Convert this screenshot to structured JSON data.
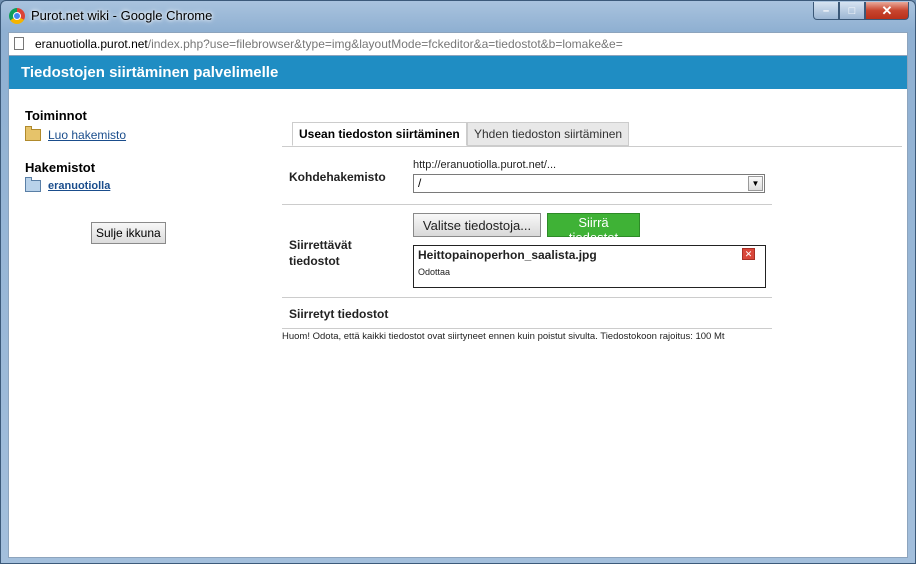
{
  "window": {
    "title": "Purot.net wiki - Google Chrome",
    "controls": {
      "minimize": "–",
      "maximize": "□",
      "close": "✕"
    }
  },
  "address": {
    "host": "eranuotiolla.purot.net",
    "path": "/index.php?use=filebrowser&type=img&layoutMode=fckeditor&a=tiedostot&b=lomake&e="
  },
  "header": {
    "title": "Tiedostojen siirtäminen palvelimelle"
  },
  "sidebar": {
    "actions_heading": "Toiminnot",
    "create_folder_link": "Luo hakemisto",
    "folders_heading": "Hakemistot",
    "folder_link": "eranuotiolla",
    "close_button": "Sulje ikkuna"
  },
  "tabs": {
    "multi": "Usean tiedoston siirtäminen",
    "single": "Yhden tiedoston siirtäminen"
  },
  "form": {
    "target_label": "Kohdehakemisto",
    "target_hint": "http://eranuotiolla.purot.net/...",
    "target_value": "/",
    "files_label_line1": "Siirrettävät",
    "files_label_line2": "tiedostot",
    "choose_button": "Valitse tiedostoja...",
    "upload_button": "Siirrä tiedostot",
    "queued_file": "Heittopainoperhon_saalista.jpg",
    "queued_status": "Odottaa",
    "done_label": "Siirretyt tiedostot",
    "note": "Huom! Odota, että kaikki tiedostot ovat siirtyneet ennen kuin poistut sivulta. Tiedostokoon rajoitus: 100 Mt"
  },
  "colors": {
    "header_bg": "#1f8dc3",
    "upload_button_bg": "#3fb236",
    "link": "#1a4d8c"
  }
}
